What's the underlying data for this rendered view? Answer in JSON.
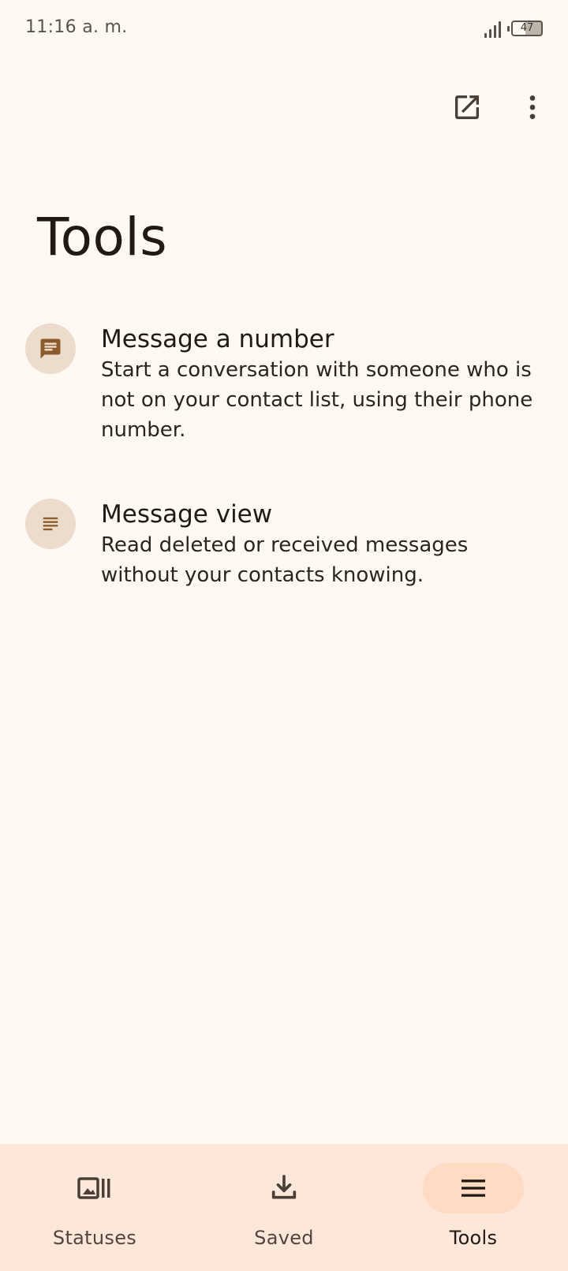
{
  "status_bar": {
    "time": "11:16 a. m.",
    "battery": "47"
  },
  "toolbar": {
    "share_icon": "open-in-new-icon",
    "more_icon": "more-vert-icon"
  },
  "page": {
    "title": "Tools"
  },
  "tools": [
    {
      "icon": "chat-icon",
      "title": "Message a number",
      "description": "Start a conversation with someone who is not on your contact list, using their phone number."
    },
    {
      "icon": "notes-icon",
      "title": "Message view",
      "description": "Read deleted or received messages without your contacts knowing."
    }
  ],
  "bottom_nav": {
    "items": [
      {
        "label": "Statuses",
        "icon": "statuses-icon",
        "active": false
      },
      {
        "label": "Saved",
        "icon": "download-icon",
        "active": false
      },
      {
        "label": "Tools",
        "icon": "menu-icon",
        "active": true
      }
    ]
  },
  "colors": {
    "background": "#fff8f3",
    "nav_background": "#fde7da",
    "nav_active_pill": "#ffdbc4",
    "icon_circle": "#ecdccc",
    "icon_tint": "#8b5a2b"
  }
}
